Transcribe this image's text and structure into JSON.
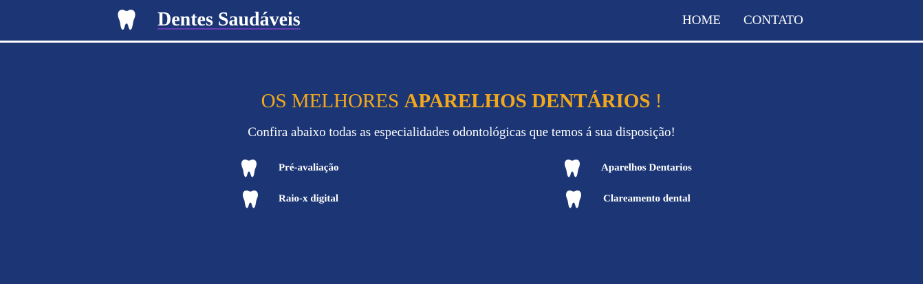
{
  "header": {
    "brand_icon": "tooth-icon",
    "brand_title": "Dentes Saudáveis",
    "nav": [
      {
        "label": "HOME"
      },
      {
        "label": "CONTATO"
      }
    ]
  },
  "hero": {
    "title_prefix": "OS MELHORES ",
    "title_highlight": "APARELHOS DENTÁRIOS",
    "title_suffix": " !",
    "subtitle": "Confira abaixo todas as especialidades odontológicas que temos á sua disposição!"
  },
  "services": [
    {
      "icon": "tooth-icon",
      "label": "Pré-avaliação"
    },
    {
      "icon": "tooth-icon",
      "label": "Aparelhos Dentarios"
    },
    {
      "icon": "tooth-icon",
      "label": "Raio-x digital"
    },
    {
      "icon": "tooth-icon",
      "label": "Clareamento dental"
    }
  ],
  "colors": {
    "background": "#1b3575",
    "accent": "#f3a81c",
    "text": "#ffffff"
  }
}
